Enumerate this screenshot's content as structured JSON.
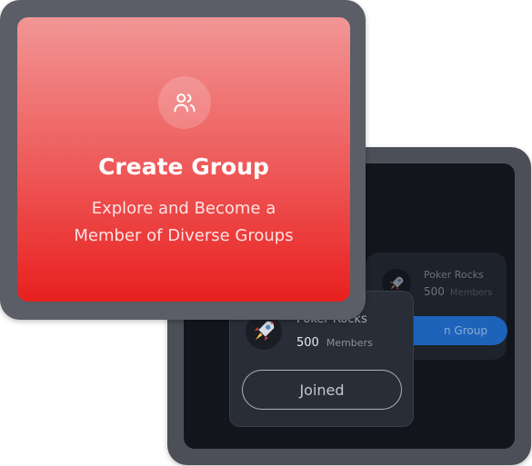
{
  "create_card": {
    "icon": "users-icon",
    "title": "Create Group",
    "subtitle_line1": "Explore and Become a",
    "subtitle_line2": "Member of Diverse Groups",
    "gradient_top": "#f19695",
    "gradient_bottom": "#e8201f"
  },
  "background_card": {
    "icon": "rocket-icon",
    "name": "Poker Rocks",
    "count": "500",
    "count_label": "Members",
    "button_label": "n Group",
    "button_color": "#1d6fd3"
  },
  "group_card": {
    "icon": "rocket-icon",
    "name": "Poker Rocks",
    "count": "500",
    "count_label": "Members",
    "button_label": "Joined"
  }
}
